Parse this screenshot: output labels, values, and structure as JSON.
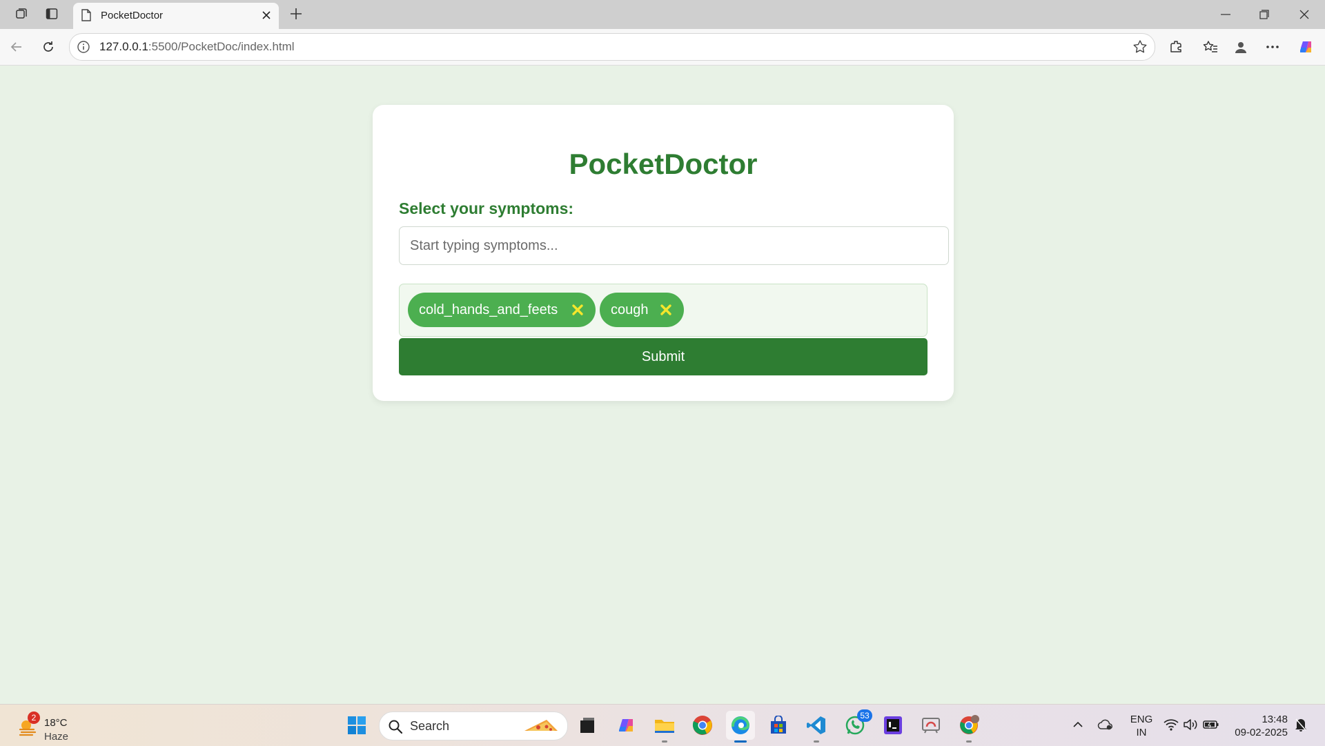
{
  "browser": {
    "tab_title": "PocketDoctor",
    "url_host": "127.0.0.1",
    "url_path": ":5500/PocketDoc/index.html"
  },
  "app": {
    "title": "PocketDoctor",
    "select_label": "Select your symptoms:",
    "search_placeholder": "Start typing symptoms...",
    "selected_symptoms": [
      "cold_hands_and_feets",
      "cough"
    ],
    "submit_label": "Submit"
  },
  "taskbar": {
    "weather_temp": "18°C",
    "weather_condition": "Haze",
    "weather_badge": "2",
    "search_label": "Search",
    "whatsapp_badge": "53",
    "lang_line1": "ENG",
    "lang_line2": "IN",
    "time": "13:48",
    "date": "09-02-2025"
  },
  "colors": {
    "brand_green": "#2e7d32",
    "chip_green": "#4caf50",
    "chip_remove": "#f5e62c",
    "page_background": "#e8f2e6"
  }
}
